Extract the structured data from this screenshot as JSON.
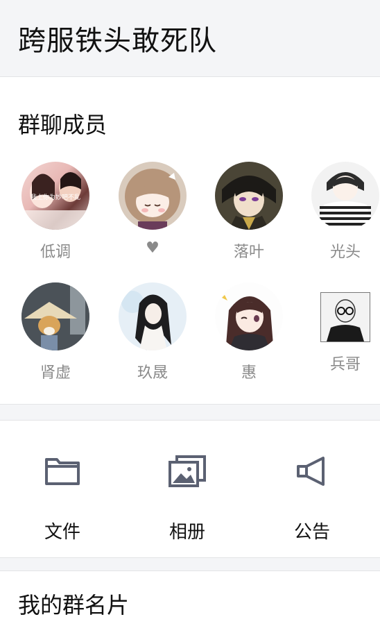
{
  "header": {
    "title": "跨服铁头敢死队"
  },
  "members_section": {
    "title": "群聊成员"
  },
  "members": [
    {
      "name": "低调",
      "avatar_icon": "couple-photo-avatar",
      "overlay": "我上你为妙吧不乱"
    },
    {
      "name": "♥",
      "avatar_icon": "anime-girl-avatar"
    },
    {
      "name": "落叶",
      "avatar_icon": "anime-boy-avatar"
    },
    {
      "name": "光头",
      "avatar_icon": "striped-boy-avatar"
    },
    {
      "name": "肾虚",
      "avatar_icon": "dog-hat-avatar"
    },
    {
      "name": "玖晟",
      "avatar_icon": "ink-art-avatar"
    },
    {
      "name": "惠",
      "avatar_icon": "wink-girl-avatar"
    },
    {
      "name": "兵哥",
      "avatar_icon": "old-man-sketch-avatar"
    }
  ],
  "tools": [
    {
      "label": "文件",
      "icon": "folder-icon"
    },
    {
      "label": "相册",
      "icon": "photo-album-icon"
    },
    {
      "label": "公告",
      "icon": "megaphone-icon"
    }
  ],
  "group_card": {
    "title": "我的群名片"
  },
  "colors": {
    "icon": "#5b6172",
    "muted_text": "#8a8a8a"
  }
}
